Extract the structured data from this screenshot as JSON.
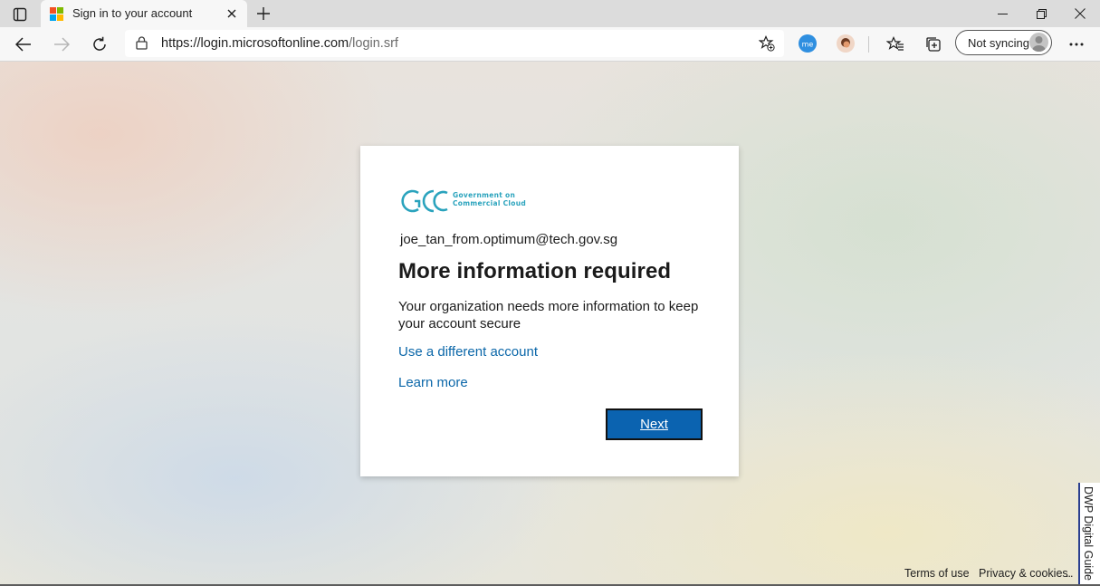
{
  "browser": {
    "tab_title": "Sign in to your account",
    "url_host": "https://login.microsoftonline.com",
    "url_path": "/login.srf",
    "sync_label": "Not syncing",
    "icons": {
      "tab_actions": "tab-actions-icon",
      "close_tab": "close-icon",
      "new_tab": "plus-icon",
      "back": "back-arrow-icon",
      "forward": "forward-arrow-icon",
      "refresh": "refresh-icon",
      "lock": "lock-icon",
      "add_favorite": "star-plus-icon",
      "favorites": "favorites-icon",
      "collections": "collections-icon",
      "more": "more-icon"
    }
  },
  "card": {
    "logo_line1": "Government on",
    "logo_line2": "Commercial Cloud",
    "email": "joe_tan_from.optimum@tech.gov.sg",
    "heading": "More information required",
    "description": "Your organization needs more information to keep your account secure",
    "use_different_account": "Use a different account",
    "learn_more": "Learn more",
    "next_label": "Next"
  },
  "footer": {
    "terms": "Terms of use",
    "privacy": "Privacy & cookies",
    "more": "...",
    "dwp_guide": "DWP Digital Guide"
  },
  "colors": {
    "link": "#0b67a9",
    "primary_button": "#0b63b0",
    "logo_teal": "#2aa3bd"
  }
}
